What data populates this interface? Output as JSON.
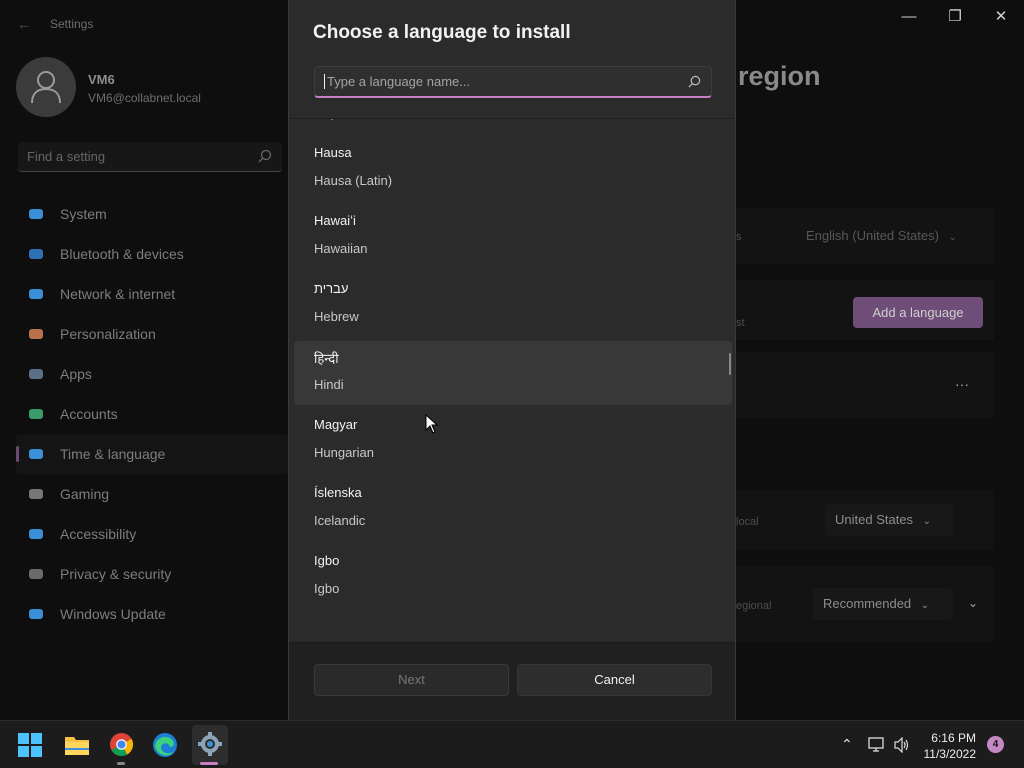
{
  "settings": {
    "app_title": "Settings",
    "user": {
      "name": "VM6",
      "email": "VM6@collabnet.local"
    },
    "search_placeholder": "Find a setting",
    "nav": [
      {
        "label": "System",
        "icon": "display-icon",
        "color": "#3a8fd6"
      },
      {
        "label": "Bluetooth & devices",
        "icon": "bluetooth-icon",
        "color": "#2f6fb5"
      },
      {
        "label": "Network & internet",
        "icon": "wifi-icon",
        "color": "#3a8fd6"
      },
      {
        "label": "Personalization",
        "icon": "brush-icon",
        "color": "#b8714a"
      },
      {
        "label": "Apps",
        "icon": "apps-icon",
        "color": "#5c6f86"
      },
      {
        "label": "Accounts",
        "icon": "person-icon",
        "color": "#3a9a6a"
      },
      {
        "label": "Time & language",
        "icon": "globe-clock-icon",
        "color": "#3a8fd6"
      },
      {
        "label": "Gaming",
        "icon": "gamepad-icon",
        "color": "#777777"
      },
      {
        "label": "Accessibility",
        "icon": "accessibility-icon",
        "color": "#3a8fd6"
      },
      {
        "label": "Privacy & security",
        "icon": "shield-icon",
        "color": "#6a6a6a"
      },
      {
        "label": "Windows Update",
        "icon": "update-icon",
        "color": "#3a8fd6"
      }
    ],
    "active_nav_index": 6,
    "page_heading": "region",
    "display_language_value": "English (United States)",
    "display_language_hint": "s",
    "preferred_hint": "st",
    "add_language_label": "Add a language",
    "country_hint": "local",
    "country_value": "United States",
    "regional_hint": "egional",
    "regional_value": "Recommended",
    "more_label": "···"
  },
  "dialog": {
    "title": "Choose a language to install",
    "search_placeholder": "Type a language name...",
    "languages": [
      {
        "native": "",
        "english": "Gujarati"
      },
      {
        "native": "Hausa",
        "english": "Hausa (Latin)"
      },
      {
        "native": "Hawaiʻi",
        "english": "Hawaiian"
      },
      {
        "native": "עברית",
        "english": "Hebrew"
      },
      {
        "native": "हिन्दी",
        "english": "Hindi"
      },
      {
        "native": "Magyar",
        "english": "Hungarian"
      },
      {
        "native": "Íslenska",
        "english": "Icelandic"
      },
      {
        "native": "Igbo",
        "english": "Igbo"
      }
    ],
    "hovered_index": 4,
    "next_label": "Next",
    "cancel_label": "Cancel"
  },
  "taskbar": {
    "apps": [
      "start-icon",
      "file-explorer-icon",
      "chrome-icon",
      "edge-icon",
      "settings-icon"
    ],
    "time": "6:16 PM",
    "date": "11/3/2022",
    "notification_count": "4"
  },
  "accent_color": "#c780c4"
}
